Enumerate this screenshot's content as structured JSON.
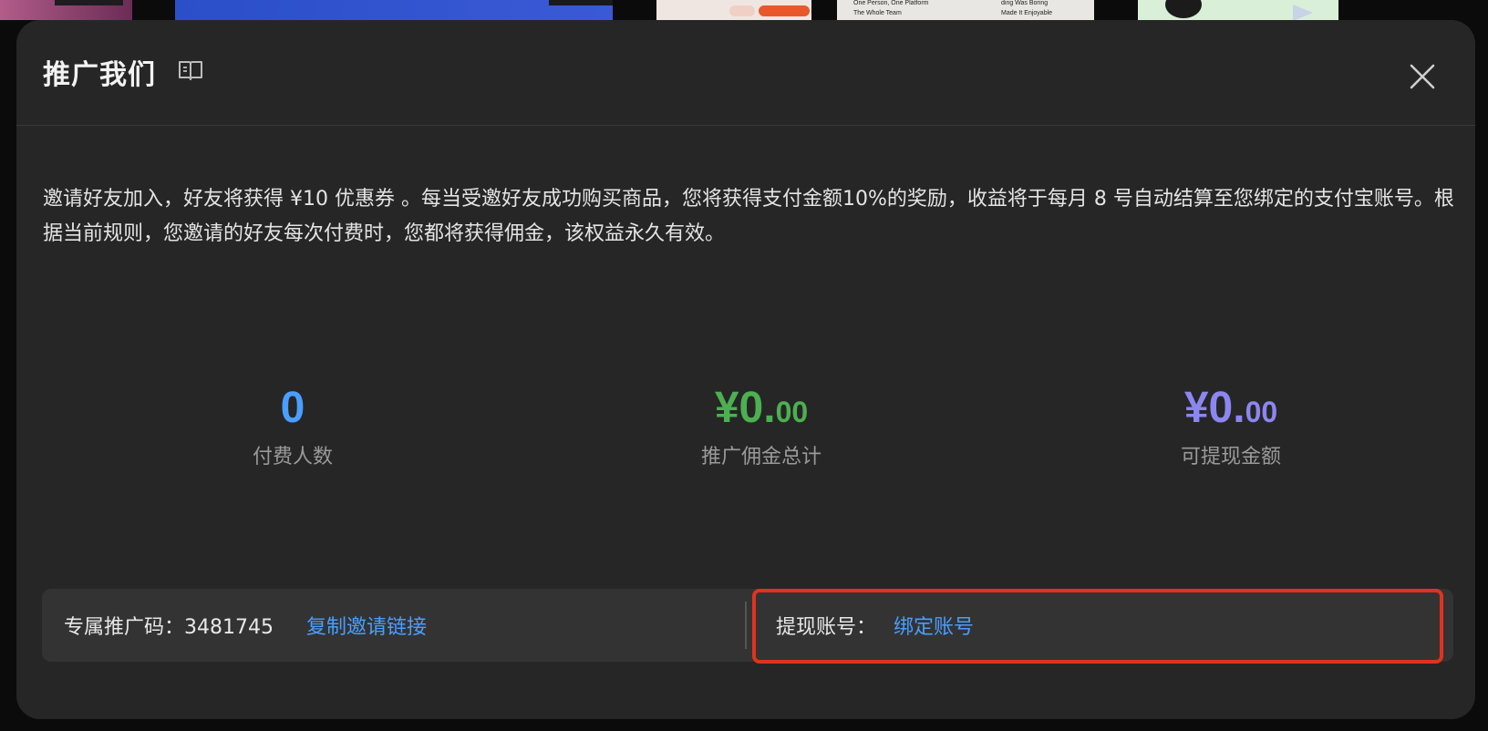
{
  "background": {
    "thumb4_lines": [
      "One Person, One Platform",
      "The Whole Team",
      "ding Was Boring",
      "Made It Enjoyable"
    ]
  },
  "modal": {
    "title": "推广我们",
    "description": "邀请好友加入，好友将获得 ¥10 优惠券 。每当受邀好友成功购买商品，您将获得支付金额10%的奖励，收益将于每月 8 号自动结算至您绑定的支付宝账号。根据当前规则，您邀请的好友每次付费时，您都将获得佣金，该权益永久有效。",
    "stats": [
      {
        "value": "0",
        "label": "付费人数",
        "color": "#4a9eff"
      },
      {
        "value_main": "¥0.",
        "value_cents": "00",
        "label": "推广佣金总计",
        "color": "#4cb050"
      },
      {
        "value_main": "¥0.",
        "value_cents": "00",
        "label": "可提现金额",
        "color": "#8c86f0"
      }
    ],
    "promo": {
      "label": "专属推广码：3481745",
      "copy_link": "复制邀请链接"
    },
    "withdraw": {
      "label": "提现账号：",
      "bind_link": "绑定账号"
    }
  },
  "colors": {
    "link": "#4a9eff",
    "highlight": "#e1321f",
    "modal_bg": "#262626"
  }
}
